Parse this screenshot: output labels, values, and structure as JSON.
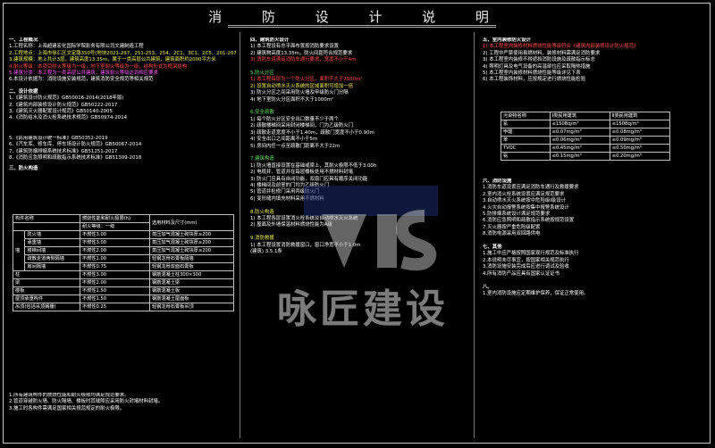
{
  "title": "消 防 设 计 说 明",
  "col1": {
    "s1_title": "一、工程概况",
    "s1_lines": [
      "1.工程名称：上海超建宏化国际学院影务有限公司文建制造工程",
      "2.工程地点：上海市徐汇区文定路350号(地块2021-297、251-253、254、2C1、3C1、2C5、201-207)",
      "3.建筑规模：地上共计3层，建筑高度13.35m，属于一类高层公共建筑，建筑面积约2000平方米",
      "4.耐火等级：本项目耐火等级为一级，地下室耐火等级为一级，结构形式为框架结构",
      "5.建筑分类：本工程为一类高层公共建筑，建筑耐火等级达到相应要求",
      "6.本设计依据为：消防设施安装规范，建筑消防安全规范等相关规范"
    ],
    "s2_title": "二、设计依据",
    "s2_lines": [
      "1.《建筑设计防火规范》GB50016-2014(2018年版)",
      "2.《建筑内部装修设计防火规范》GB50222-2017",
      "3.《建筑灭火器配置设计规范》GB50140-2005",
      "4.《消防给水及消火栓系统技术规范》GB50974-2014",
      "5.《民用建筑设计统一标准》GB50352-2019",
      "6.《汽车库、修车库、停车场设计防火规范》GB50067-2014",
      "7.《建筑防烟排烟系统技术标准》GB51251-2017",
      "8.《消防应急照明和疏散指示系统技术标准》GB51309-2018"
    ],
    "s3_title": "三、防火构造",
    "table_headers": [
      "构件名称",
      "燃烧性能和耐火极限(h)",
      "选用材料及尺寸(mm)"
    ],
    "table_sub": "耐火等级：一级",
    "table_rows": [
      [
        "墙",
        "防火墙",
        "不燃性3.00",
        "蒸压加气混凝土砌块厚≥200"
      ],
      [
        "",
        "承重墙",
        "不燃性3.00",
        "蒸压加气混凝土砌块厚≥200"
      ],
      [
        "",
        "楼梯间墙",
        "不燃性2.00",
        "蒸压加气混凝土砌块厚≥200"
      ],
      [
        "",
        "疏散走道两侧隔墙",
        "不燃性1.00",
        "轻钢龙骨石膏板隔墙"
      ],
      [
        "",
        "房间隔墙",
        "不燃性0.75",
        "轻钢龙骨双面石膏板"
      ],
      [
        "柱",
        "",
        "不燃性3.00",
        "钢筋混凝土柱300×300"
      ],
      [
        "梁",
        "",
        "不燃性2.00",
        "钢筋混凝土梁"
      ],
      [
        "楼板",
        "",
        "不燃性1.50",
        "钢筋混凝土板"
      ],
      [
        "屋顶承重构件",
        "",
        "不燃性1.50",
        "钢筋混凝土屋面板"
      ],
      [
        "吊顶(包括吊顶搁栅)",
        "",
        "不燃性0.25",
        "轻钢龙骨石膏板吊顶"
      ]
    ],
    "notes": [
      "1.所有建筑构件的燃烧性能和耐火极限均满足规范要求。",
      "2.管道穿越防火墙、防火隔墙、楼板时其缝隙应采用防火封堵材料封堵。",
      "3.施工时各构件需满足国家相关规范规定的耐火极限。"
    ]
  },
  "col2": {
    "s4_title": "四、建筑防火设计",
    "s4_lines": [
      "1) 本工程设有总平面布置按消防要求设置",
      "2) 建筑物高度13.35m，防火间距符合规范要求",
      "3) 消防车道满足消防车通行要求，宽度不小于4m"
    ],
    "s5_title": "5.防火分区",
    "s5_lines": [
      "1) 本工程每层为一个防火分区，面积不大于2500m²",
      "2) 设置自动喷水灭火系统的区域面积可增加一倍",
      "3) 防火分区之间采用防火墙及甲级防火门分隔",
      "4) 地下室防火分区面积不大于1000m²"
    ],
    "s6_title": "6.安全疏散",
    "s6_lines": [
      "1) 每个防火分区安全出口数量不少于两个",
      "2) 疏散楼梯间采用封闭楼梯间，门为乙级防火门",
      "3) 疏散走道宽度不小于1.40m，疏散门宽度不小于0.90m",
      "4) 安全出口之间距离不小于5m",
      "5) 房间内任一点至疏散门距离不大于22m"
    ],
    "s7_title": "7.建筑构造",
    "s7_lines": [
      "1) 防火墙直接设置在基础或梁上，其耐火极限不低于3.00h",
      "2) 电缆井、管道井在每层楼板处用不燃材料封堵",
      "3) 防火门应具有自闭功能，双扇门应具有顺序关闭功能",
      "4) 楼梯间及前室的门均为乙级防火门",
      "5) 管道井检修门采用丙级防火门",
      "6) 变形缝内填充材料采用不燃材料"
    ],
    "s8_title": "8.防火构造",
    "s8_lines": [
      "1) 本工程各层设置消火栓系统及自动喷水灭火系统",
      "2) 屋面及外墙保温材料燃烧性能为A级"
    ],
    "s9_title": "9.消防救援",
    "s9_lines": [
      "1) 本工程设置消防救援窗口，窗口净宽不小于1.0m",
      "(建筑) 3.5.1条"
    ]
  },
  "col3": {
    "s10_title": "五、室内装修防火设计",
    "s10_lines": [
      "1) 本工程室内装修材料燃烧性能等级符合《建筑内部装修设计防火规范》",
      "2) 工程中严禁使用易燃材料，装修材料需满足消防要求",
      "3) 本工程室内装修不得遮挡消防设施及疏散指示标志",
      "4) 照明灯具及电气设备的高温部位应采取隔热措施",
      "5) 本工程室内装修材料燃烧性能等级详见下表",
      "6) 本工程装饰材料，应按规定进行燃烧性能检验"
    ],
    "small_table_headers": [
      "污染物名称",
      "Ⅰ类民用建筑",
      "Ⅱ类民用建筑"
    ],
    "small_table_rows": [
      [
        "氡",
        "≤150Bq/m³",
        "≤150Bq/m³"
      ],
      [
        "甲醛",
        "≤0.07mg/m³",
        "≤0.08mg/m³"
      ],
      [
        "苯",
        "≤0.06mg/m³",
        "≤0.09mg/m³"
      ],
      [
        "TVOC",
        "≤0.45mg/m³",
        "≤0.50mg/m³"
      ],
      [
        "氨",
        "≤0.15mg/m³",
        "≤0.20mg/m³"
      ]
    ],
    "s11_title": "六、消防设施",
    "s11_lines": [
      "1.消防车道设置应满足消防车通行及救援要求",
      "2.室内消火栓系统设置应满足规范要求",
      "3.自动喷水灭火系统按中危险级Ⅰ级设计",
      "4.火灾自动报警系统按集中报警系统设计",
      "5.防排烟系统设计满足规范要求",
      "6.消防应急照明和疏散指示系统按规范设置",
      "7.灭火器按严重危险级配置",
      "8.消防电源采用双回路供电"
    ],
    "s12_title": "七、其他",
    "s12_lines": [
      "1.施工中应严格按照国家现行规范及标准执行",
      "2.本说明未尽事宜，按国家相关规范执行",
      "3.消防设施安装完成后应进行调试及验收",
      "4.所有消防产品应具有国家认证证书"
    ],
    "s13_title": "八、",
    "s13_lines": [
      "1.室内消防设施应定期维护保养，保证正常使用。"
    ]
  },
  "watermark": "咏匠建设"
}
